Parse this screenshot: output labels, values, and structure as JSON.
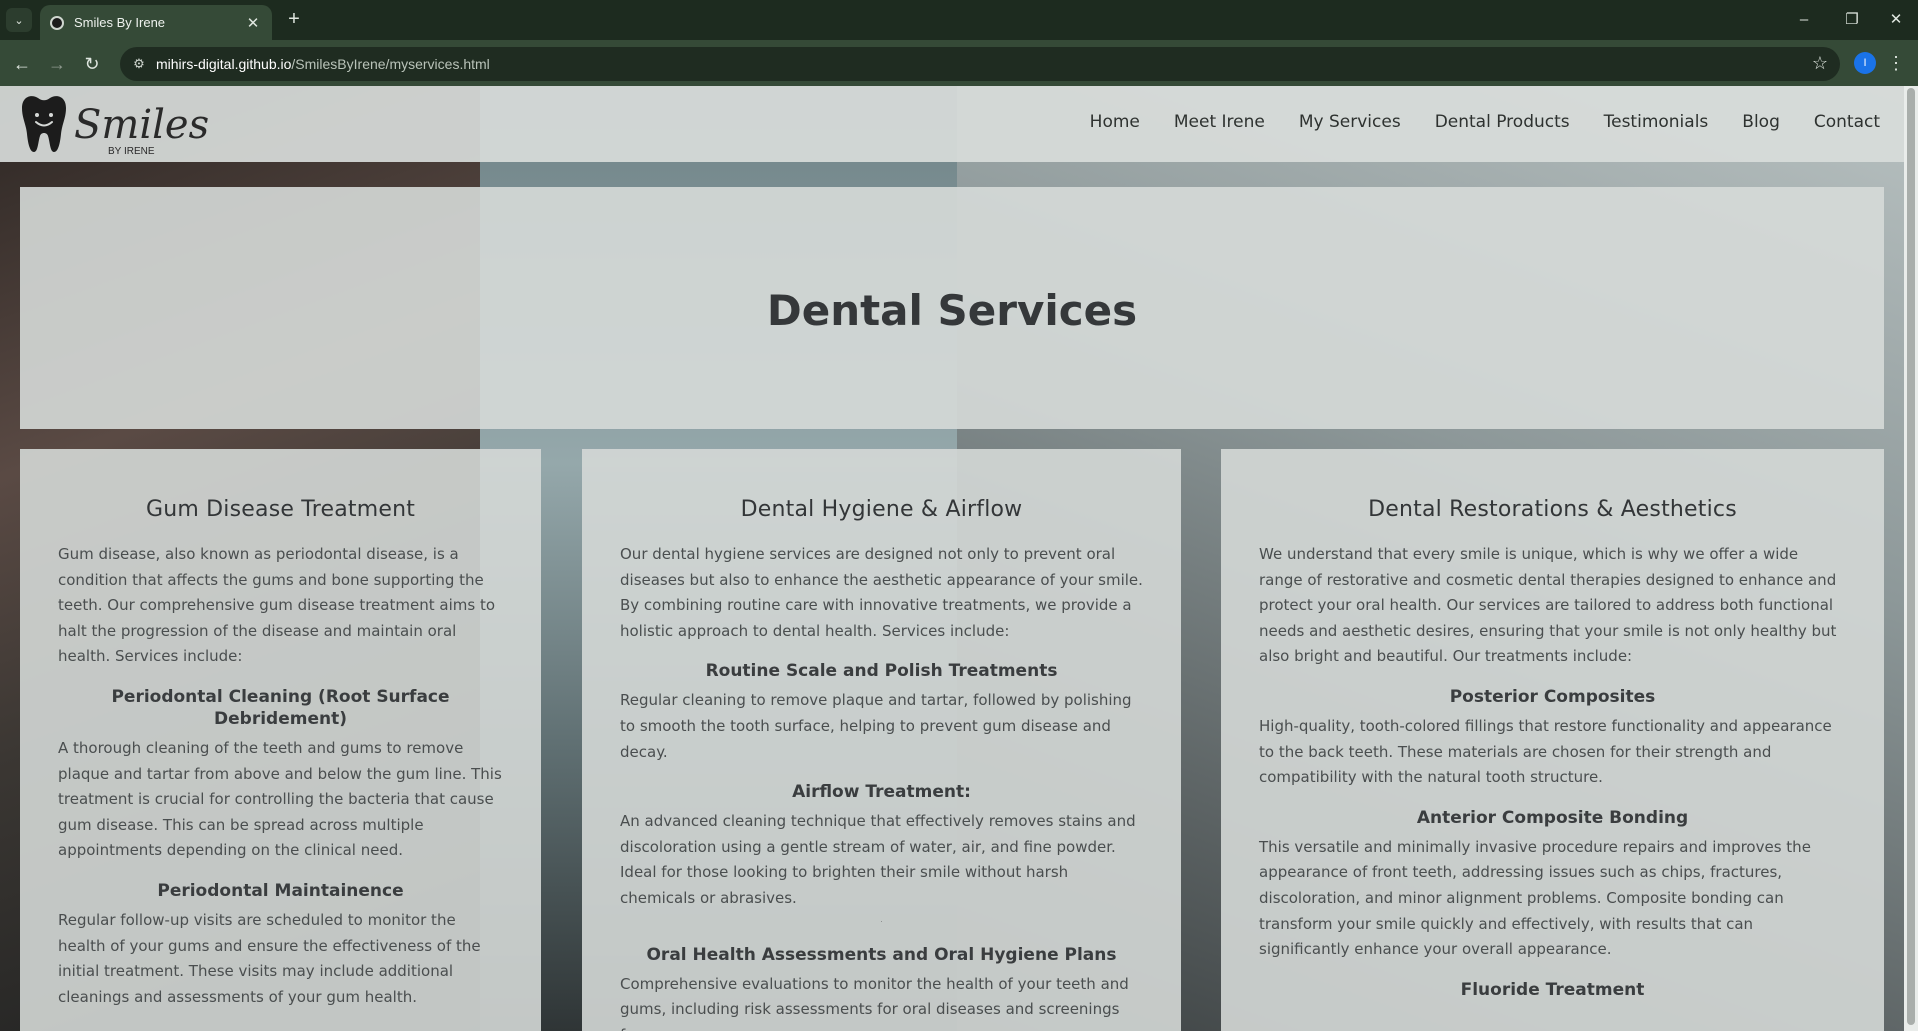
{
  "browser": {
    "tab_title": "Smiles By Irene",
    "url_host": "mihirs-digital.github.io",
    "url_path": "/SmilesByIrene/myservices.html",
    "profile_initial": "I",
    "tab_list_icon": "⌄",
    "tab_close_icon": "✕",
    "new_tab_icon": "+",
    "minimize_icon": "–",
    "restore_icon": "❐",
    "close_window_icon": "✕",
    "back_icon": "←",
    "forward_icon": "→",
    "reload_icon": "↻",
    "site_info_icon": "⚙",
    "bookmark_icon": "☆",
    "menu_icon": "⋮"
  },
  "site": {
    "logo_text": "Smiles",
    "logo_subtext": "BY IRENE",
    "nav": [
      "Home",
      "Meet Irene",
      "My Services",
      "Dental Products",
      "Testimonials",
      "Blog",
      "Contact"
    ]
  },
  "hero": {
    "title": "Dental Services"
  },
  "cards": [
    {
      "title": "Gum Disease Treatment",
      "intro": "Gum disease, also known as periodontal disease, is a condition that affects the gums and bone supporting the teeth. Our comprehensive gum disease treatment aims to halt the progression of the disease and maintain oral health. Services include:",
      "sections": [
        {
          "heading": "Periodontal Cleaning (Root Surface Debridement)",
          "text": "A thorough cleaning of the teeth and gums to remove plaque and tartar from above and below the gum line. This treatment is crucial for controlling the bacteria that cause gum disease. This can be spread across multiple appointments depending on the clinical need."
        },
        {
          "heading": "Periodontal Maintainence",
          "text": "Regular follow-up visits are scheduled to monitor the health of your gums and ensure the effectiveness of the initial treatment. These visits may include additional cleanings and assessments of your gum health."
        }
      ]
    },
    {
      "title": "Dental Hygiene & Airflow",
      "intro": "Our dental hygiene services are designed not only to prevent oral diseases but also to enhance the aesthetic appearance of your smile. By combining routine care with innovative treatments, we provide a holistic approach to dental health. Services include:",
      "sections": [
        {
          "heading": "Routine Scale and Polish Treatments",
          "text": "Regular cleaning to remove plaque and tartar, followed by polishing to smooth the tooth surface, helping to prevent gum disease and decay."
        },
        {
          "heading": "Airflow Treatment:",
          "text": "An advanced cleaning technique that effectively removes stains and discoloration using a gentle stream of water, air, and fine powder. Ideal for those looking to brighten their smile without harsh chemicals or abrasives."
        },
        {
          "heading": "Oral Health Assessments and Oral Hygiene Plans",
          "text": "Comprehensive evaluations to monitor the health of your teeth and gums, including risk assessments for oral diseases and screenings for"
        }
      ]
    },
    {
      "title": "Dental Restorations & Aesthetics",
      "intro": "We understand that every smile is unique, which is why we offer a wide range of restorative and cosmetic dental therapies designed to enhance and protect your oral health. Our services are tailored to address both functional needs and aesthetic desires, ensuring that your smile is not only healthy but also bright and beautiful. Our treatments include:",
      "sections": [
        {
          "heading": "Posterior Composites",
          "text": "High-quality, tooth-colored fillings that restore functionality and appearance to the back teeth. These materials are chosen for their strength and compatibility with the natural tooth structure."
        },
        {
          "heading": "Anterior Composite Bonding",
          "text": "This versatile and minimally invasive procedure repairs and improves the appearance of front teeth, addressing issues such as chips, fractures, discoloration, and minor alignment problems. Composite bonding can transform your smile quickly and effectively, with results that can significantly enhance your overall appearance."
        },
        {
          "heading": "Fluoride Treatment",
          "text": ""
        }
      ]
    }
  ]
}
